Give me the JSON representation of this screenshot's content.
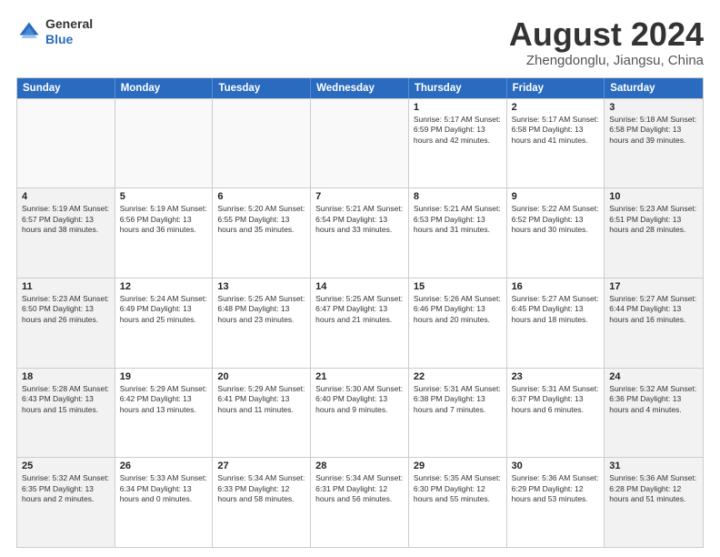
{
  "header": {
    "logo_general": "General",
    "logo_blue": "Blue",
    "month_title": "August 2024",
    "location": "Zhengdonglu, Jiangsu, China"
  },
  "weekdays": [
    "Sunday",
    "Monday",
    "Tuesday",
    "Wednesday",
    "Thursday",
    "Friday",
    "Saturday"
  ],
  "rows": [
    [
      {
        "day": "",
        "info": "",
        "empty": true
      },
      {
        "day": "",
        "info": "",
        "empty": true
      },
      {
        "day": "",
        "info": "",
        "empty": true
      },
      {
        "day": "",
        "info": "",
        "empty": true
      },
      {
        "day": "1",
        "info": "Sunrise: 5:17 AM\nSunset: 6:59 PM\nDaylight: 13 hours\nand 42 minutes.",
        "shade": false
      },
      {
        "day": "2",
        "info": "Sunrise: 5:17 AM\nSunset: 6:58 PM\nDaylight: 13 hours\nand 41 minutes.",
        "shade": false
      },
      {
        "day": "3",
        "info": "Sunrise: 5:18 AM\nSunset: 6:58 PM\nDaylight: 13 hours\nand 39 minutes.",
        "shade": true
      }
    ],
    [
      {
        "day": "4",
        "info": "Sunrise: 5:19 AM\nSunset: 6:57 PM\nDaylight: 13 hours\nand 38 minutes.",
        "shade": true
      },
      {
        "day": "5",
        "info": "Sunrise: 5:19 AM\nSunset: 6:56 PM\nDaylight: 13 hours\nand 36 minutes.",
        "shade": false
      },
      {
        "day": "6",
        "info": "Sunrise: 5:20 AM\nSunset: 6:55 PM\nDaylight: 13 hours\nand 35 minutes.",
        "shade": false
      },
      {
        "day": "7",
        "info": "Sunrise: 5:21 AM\nSunset: 6:54 PM\nDaylight: 13 hours\nand 33 minutes.",
        "shade": false
      },
      {
        "day": "8",
        "info": "Sunrise: 5:21 AM\nSunset: 6:53 PM\nDaylight: 13 hours\nand 31 minutes.",
        "shade": false
      },
      {
        "day": "9",
        "info": "Sunrise: 5:22 AM\nSunset: 6:52 PM\nDaylight: 13 hours\nand 30 minutes.",
        "shade": false
      },
      {
        "day": "10",
        "info": "Sunrise: 5:23 AM\nSunset: 6:51 PM\nDaylight: 13 hours\nand 28 minutes.",
        "shade": true
      }
    ],
    [
      {
        "day": "11",
        "info": "Sunrise: 5:23 AM\nSunset: 6:50 PM\nDaylight: 13 hours\nand 26 minutes.",
        "shade": true
      },
      {
        "day": "12",
        "info": "Sunrise: 5:24 AM\nSunset: 6:49 PM\nDaylight: 13 hours\nand 25 minutes.",
        "shade": false
      },
      {
        "day": "13",
        "info": "Sunrise: 5:25 AM\nSunset: 6:48 PM\nDaylight: 13 hours\nand 23 minutes.",
        "shade": false
      },
      {
        "day": "14",
        "info": "Sunrise: 5:25 AM\nSunset: 6:47 PM\nDaylight: 13 hours\nand 21 minutes.",
        "shade": false
      },
      {
        "day": "15",
        "info": "Sunrise: 5:26 AM\nSunset: 6:46 PM\nDaylight: 13 hours\nand 20 minutes.",
        "shade": false
      },
      {
        "day": "16",
        "info": "Sunrise: 5:27 AM\nSunset: 6:45 PM\nDaylight: 13 hours\nand 18 minutes.",
        "shade": false
      },
      {
        "day": "17",
        "info": "Sunrise: 5:27 AM\nSunset: 6:44 PM\nDaylight: 13 hours\nand 16 minutes.",
        "shade": true
      }
    ],
    [
      {
        "day": "18",
        "info": "Sunrise: 5:28 AM\nSunset: 6:43 PM\nDaylight: 13 hours\nand 15 minutes.",
        "shade": true
      },
      {
        "day": "19",
        "info": "Sunrise: 5:29 AM\nSunset: 6:42 PM\nDaylight: 13 hours\nand 13 minutes.",
        "shade": false
      },
      {
        "day": "20",
        "info": "Sunrise: 5:29 AM\nSunset: 6:41 PM\nDaylight: 13 hours\nand 11 minutes.",
        "shade": false
      },
      {
        "day": "21",
        "info": "Sunrise: 5:30 AM\nSunset: 6:40 PM\nDaylight: 13 hours\nand 9 minutes.",
        "shade": false
      },
      {
        "day": "22",
        "info": "Sunrise: 5:31 AM\nSunset: 6:38 PM\nDaylight: 13 hours\nand 7 minutes.",
        "shade": false
      },
      {
        "day": "23",
        "info": "Sunrise: 5:31 AM\nSunset: 6:37 PM\nDaylight: 13 hours\nand 6 minutes.",
        "shade": false
      },
      {
        "day": "24",
        "info": "Sunrise: 5:32 AM\nSunset: 6:36 PM\nDaylight: 13 hours\nand 4 minutes.",
        "shade": true
      }
    ],
    [
      {
        "day": "25",
        "info": "Sunrise: 5:32 AM\nSunset: 6:35 PM\nDaylight: 13 hours\nand 2 minutes.",
        "shade": true
      },
      {
        "day": "26",
        "info": "Sunrise: 5:33 AM\nSunset: 6:34 PM\nDaylight: 13 hours\nand 0 minutes.",
        "shade": false
      },
      {
        "day": "27",
        "info": "Sunrise: 5:34 AM\nSunset: 6:33 PM\nDaylight: 12 hours\nand 58 minutes.",
        "shade": false
      },
      {
        "day": "28",
        "info": "Sunrise: 5:34 AM\nSunset: 6:31 PM\nDaylight: 12 hours\nand 56 minutes.",
        "shade": false
      },
      {
        "day": "29",
        "info": "Sunrise: 5:35 AM\nSunset: 6:30 PM\nDaylight: 12 hours\nand 55 minutes.",
        "shade": false
      },
      {
        "day": "30",
        "info": "Sunrise: 5:36 AM\nSunset: 6:29 PM\nDaylight: 12 hours\nand 53 minutes.",
        "shade": false
      },
      {
        "day": "31",
        "info": "Sunrise: 5:36 AM\nSunset: 6:28 PM\nDaylight: 12 hours\nand 51 minutes.",
        "shade": true
      }
    ]
  ]
}
